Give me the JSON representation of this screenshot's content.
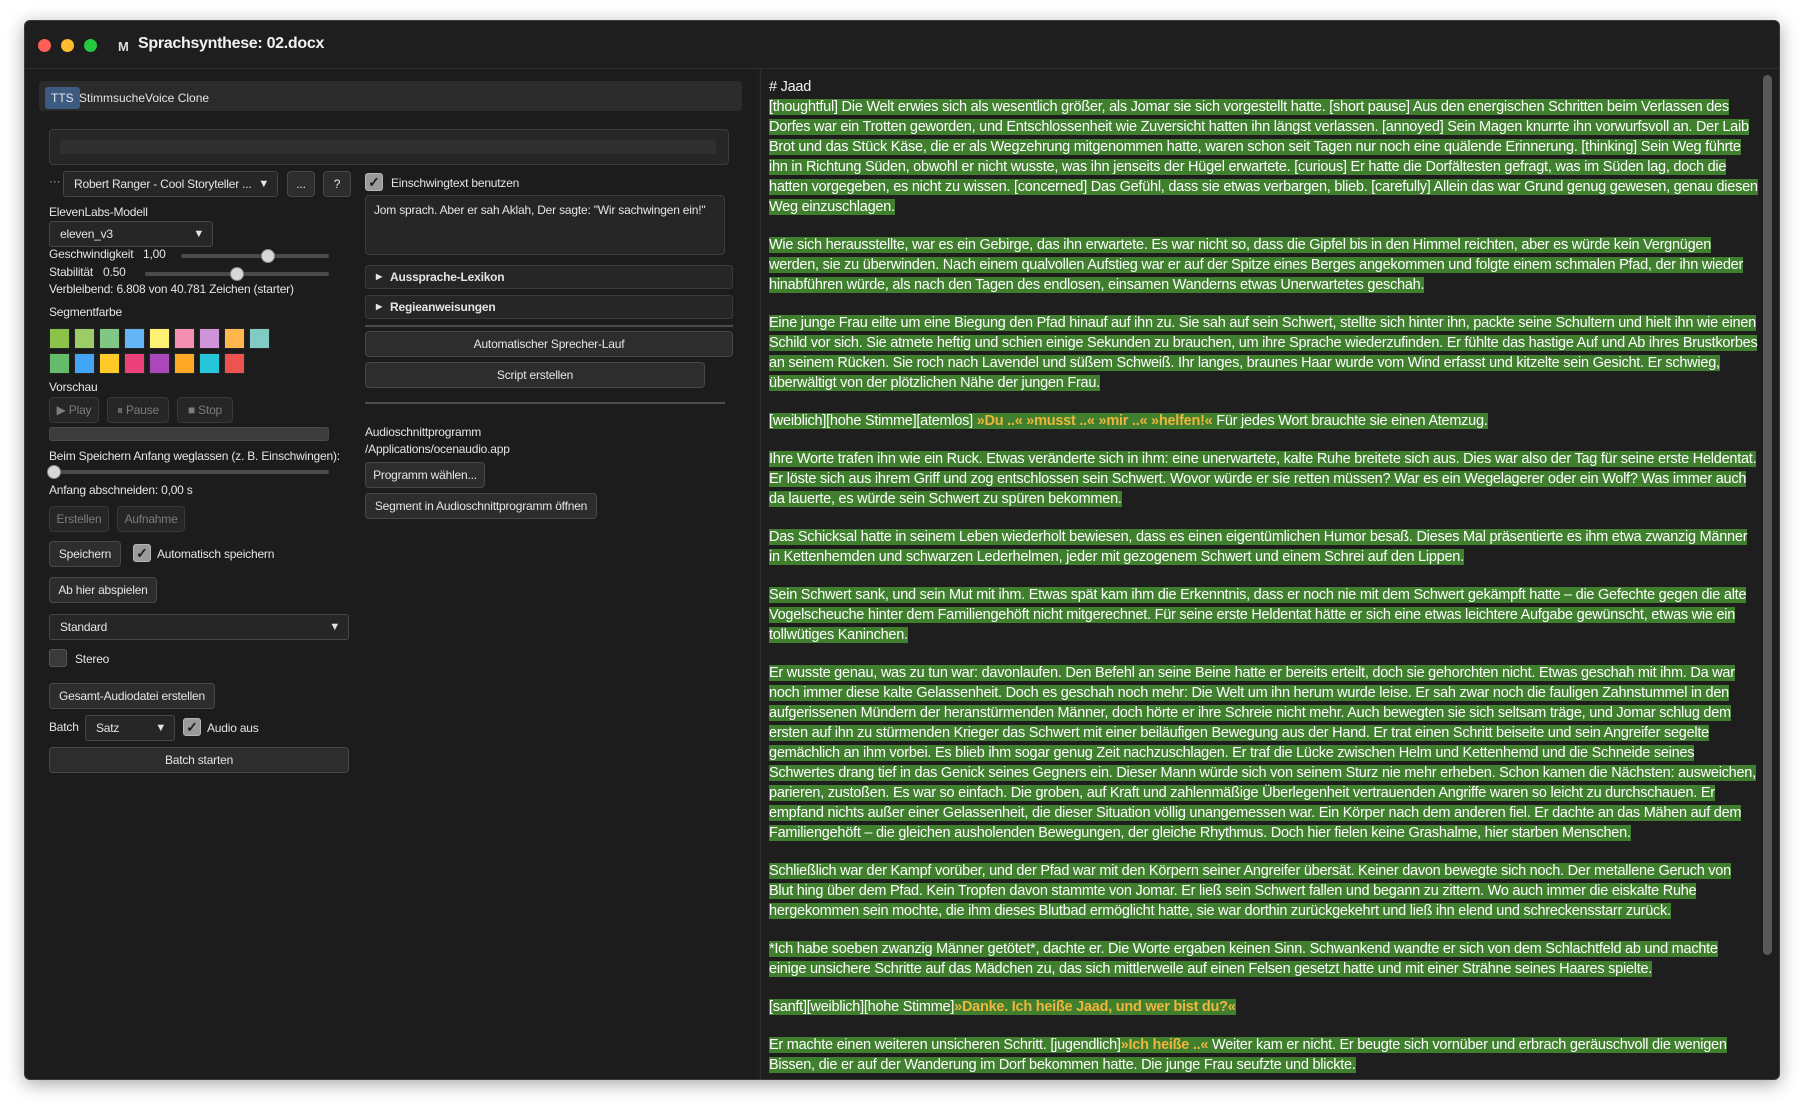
{
  "window": {
    "title": "Sprachsynthese: 02.docx",
    "app_icon": "M"
  },
  "tabs": [
    {
      "label": "TTS",
      "active": true
    },
    {
      "label": "Stimmsuche"
    },
    {
      "label": "Voice Clone"
    }
  ],
  "voice": {
    "prefix": "···",
    "selected": "Robert Ranger - Cool Storyteller ...",
    "more_label": "...",
    "help_label": "?"
  },
  "model": {
    "label": "ElevenLabs-Modell",
    "selected": "eleven_v3"
  },
  "speed": {
    "label": "Geschwindigkeit",
    "value": "1,00",
    "level": 0.58
  },
  "stability": {
    "label": "Stabilität",
    "value": "0.50",
    "level": 0.5
  },
  "remaining": "Verbleibend: 6.808 von 40.781 Zeichen (starter)",
  "segment_color": {
    "label": "Segmentfarbe",
    "colors_row1": [
      "#8bc34a",
      "#9ccc65",
      "#81c784",
      "#64b5f6",
      "#fff176",
      "#f48fb1",
      "#ce93d8",
      "#ffb74d",
      "#80cbc4"
    ],
    "colors_row2": [
      "#66bb6a",
      "#42a5f5",
      "#ffca28",
      "#ec407a",
      "#ab47bc",
      "#ffa726",
      "#26c6da",
      "#ef5350"
    ]
  },
  "preview": {
    "label": "Vorschau",
    "play": "▶ Play",
    "pause": "⏸ Pause",
    "stop": "■ Stop"
  },
  "trim": {
    "label": "Beim Speichern Anfang weglassen (z. B. Einschwingen):",
    "value_label": "Anfang abschneiden: 0,00 s",
    "level": 0.0
  },
  "actions": {
    "erstellen": "Erstellen",
    "aufnahme": "Aufnahme",
    "speichern": "Speichern",
    "auto_save": "Automatisch speichern",
    "play_from_here": "Ab hier abspielen"
  },
  "preset": {
    "selected": "Standard"
  },
  "stereo": {
    "label": "Stereo",
    "checked": false
  },
  "export_all": "Gesamt-Audiodatei erstellen",
  "batch": {
    "label": "Batch",
    "mode": "Satz",
    "audio_off_label": "Audio aus",
    "audio_off_checked": true,
    "start": "Batch starten"
  },
  "middle": {
    "einschwing_label": "Einschwingtext benutzen",
    "einschwing_checked": true,
    "einschwing_text": "Jom sprach.  Aber er sah Aklah, Der sagte: \"Wir sachwingen ein!\"",
    "lexikon": "Aussprache-Lexikon",
    "regie": "Regieanweisungen",
    "auto_speaker": "Automatischer Sprecher-Lauf",
    "script": "Script erstellen",
    "audio_program_label": "Audioschnittprogramm",
    "audio_program_path": "/Applications/ocenaudio.app",
    "choose_program": "Programm wählen...",
    "open_segment": "Segment in Audioschnittprogramm öffnen"
  },
  "document": {
    "heading": "# Jaad",
    "p1": "[thoughtful] Die Welt erwies sich als wesentlich größer, als Jomar sie sich vorgestellt hatte. [short pause] Aus den energischen Schritten beim Verlassen des Dorfes war ein Trotten geworden, und Entschlossenheit wie Zuversicht hatten ihn längst verlassen. [annoyed] Sein Magen knurrte ihn vorwurfsvoll an. Der Laib Brot und das Stück Käse, die er als Wegzehrung mitgenommen hatte, waren schon seit Tagen nur noch eine quälende Erinnerung. [thinking] Sein Weg führte ihn in Richtung Süden, obwohl er nicht wusste, was ihn jenseits der Hügel erwartete. [curious] Er hatte die Dorfältesten gefragt, was im Süden lag, doch die hatten vorgegeben, es nicht zu wissen. [concerned] Das Gefühl, dass sie etwas verbargen, blieb. [carefully] Allein das war Grund genug gewesen, genau diesen Weg einzuschlagen.",
    "p2": "Wie sich herausstellte, war es ein Gebirge, das ihn erwartete. Es war nicht so, dass die Gipfel bis in den Himmel reichten, aber es würde kein Vergnügen werden, sie zu überwinden. Nach einem qualvollen Aufstieg war er auf der Spitze eines Berges angekommen und folgte einem schmalen Pfad, der ihn wieder hinabführen würde, als nach den Tagen des endlosen, einsamen Wanderns etwas Unerwartetes geschah.",
    "p3": "Eine junge Frau eilte um eine Biegung den Pfad hinauf auf ihn zu. Sie sah auf sein Schwert, stellte sich hinter ihn, packte seine Schultern und hielt ihn wie einen Schild vor sich. Sie atmete heftig und schien einige Sekunden zu brauchen, um ihre Sprache wiederzufinden. Er fühlte das hastige Auf und Ab ihres Brustkorbes an seinem Rücken. Sie roch nach Lavendel und süßem Schweiß. Ihr langes, braunes Haar wurde vom Wind erfasst und kitzelte sein Gesicht. Er schwieg, überwältigt von der plötzlichen Nähe der jungen Frau.",
    "p4_pre": "[weiblich][hohe Stimme][atemlos] ",
    "p4_quote": "»Du ..«  »musst ..«  »mir ..«  »helfen!«",
    "p4_post": " Für jedes Wort brauchte sie einen Atemzug.",
    "p5": "Ihre Worte trafen ihn wie ein Ruck. Etwas veränderte sich in ihm: eine unerwartete, kalte Ruhe breitete sich aus. Dies war also der Tag für seine erste Heldentat. Er löste sich aus ihrem Griff und zog entschlossen sein Schwert. Wovor würde er sie retten müssen? War es ein Wegelagerer oder ein Wolf? Was immer auch da lauerte, es würde sein Schwert zu spüren bekommen.",
    "p6": "Das Schicksal hatte in seinem Leben wiederholt bewiesen, dass es einen eigentümlichen Humor besaß. Dieses Mal präsentierte es ihm etwa zwanzig Männer in Kettenhemden und schwarzen Lederhelmen, jeder mit gezogenem Schwert und einem Schrei auf den Lippen.",
    "p7": "Sein Schwert sank, und sein Mut mit ihm. Etwas spät kam ihm die Erkenntnis, dass er noch nie mit dem Schwert gekämpft hatte – die Gefechte gegen die alte Vogelscheuche hinter dem Familiengehöft nicht mitgerechnet. Für seine erste Heldentat hätte er sich eine etwas leichtere Aufgabe gewünscht, etwas wie ein tollwütiges Kaninchen.",
    "p8": "Er wusste genau, was zu tun war: davonlaufen. Den Befehl an seine Beine hatte er bereits erteilt, doch sie gehorchten nicht. Etwas geschah mit ihm. Da war noch immer diese kalte Gelassenheit. Doch es geschah noch mehr: Die Welt um ihn herum wurde leise. Er sah zwar noch die fauligen Zahnstummel in den aufgerissenen Mündern der heranstürmenden Männer, doch hörte er ihre Schreie nicht mehr. Auch bewegten sie sich seltsam träge, und Jomar schlug dem ersten auf ihn zu stürmenden Krieger das Schwert mit einer beiläufigen Bewegung aus der Hand. Er trat einen Schritt beiseite und sein Angreifer segelte gemächlich an ihm vorbei. Es blieb ihm sogar genug Zeit nachzuschlagen. Er traf die Lücke zwischen Helm und Kettenhemd und die Schneide seines Schwertes drang tief in das Genick seines Gegners ein. Dieser Mann würde sich von seinem Sturz nie mehr erheben. Schon kamen die Nächsten: ausweichen, parieren, zustoßen. Es war so einfach. Die groben, auf Kraft und zahlenmäßige Überlegenheit vertrauenden Angriffe waren so leicht zu durchschauen. Er empfand nichts außer einer Gelassenheit, die dieser Situation völlig unangemessen war. Ein Körper nach dem anderen fiel. Er dachte an das Mähen auf dem Familiengehöft – die gleichen ausholenden Bewegungen, der gleiche Rhythmus. Doch hier fielen keine Grashalme, hier starben Menschen.",
    "p9": "Schließlich war der Kampf vorüber, und der Pfad war mit den Körpern seiner Angreifer übersät. Keiner davon bewegte sich noch. Der metallene Geruch von Blut hing über dem Pfad. Kein Tropfen davon stammte von Jomar. Er ließ sein Schwert fallen und begann zu zittern. Wo auch immer die eiskalte Ruhe hergekommen sein mochte, die ihm dieses Blutbad ermöglicht hatte, sie war dorthin zurückgekehrt und ließ ihn elend und schreckensstarr zurück.",
    "p10": "*Ich habe soeben zwanzig Männer getötet*, dachte er. Die Worte ergaben keinen Sinn. Schwankend wandte er sich von dem Schlachtfeld ab und machte einige unsichere Schritte auf das Mädchen zu, das sich mittlerweile auf einen Felsen gesetzt hatte und mit einer Strähne seines Haares spielte.",
    "p11_pre": "[sanft][weiblich][hohe Stimme]",
    "p11_quote": "»Danke. Ich heiße Jaad, und wer bist du?«",
    "p12_pre": "Er machte einen weiteren unsicheren Schritt. [jugendlich]",
    "p12_quote": "»Ich heiße ..«",
    "p12_post": " Weiter kam er nicht. Er beugte sich vornüber und erbrach geräuschvoll die wenigen Bissen, die er auf der Wanderung im Dorf bekommen hatte. Die junge Frau seufzte und blickte."
  }
}
